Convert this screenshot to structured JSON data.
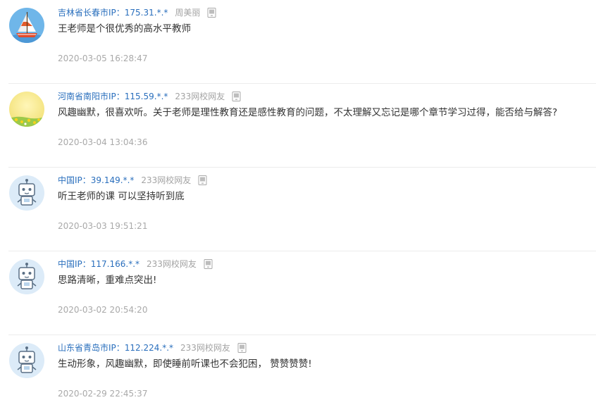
{
  "colors": {
    "location": "#2a6fbd",
    "muted": "#a3a3a3",
    "text": "#333333",
    "divider": "#ececec"
  },
  "comments": [
    {
      "avatar": "sailboat-avatar",
      "location": "吉林省长春市IP：175.31.*.*",
      "user": "周美丽",
      "content": "王老师是个很优秀的高水平教师",
      "time": "2020-03-05 16:28:47"
    },
    {
      "avatar": "flower-field-avatar",
      "location": "河南省南阳市IP：115.59.*.*",
      "user": "233网校网友",
      "content": "风趣幽默，很喜欢听。关于老师是理性教育还是感性教育的问题，不太理解又忘记是哪个章节学习过得，能否给与解答?",
      "time": "2020-03-04 13:04:36"
    },
    {
      "avatar": "robot-avatar",
      "location": "中国IP：39.149.*.*",
      "user": "233网校网友",
      "content": "听王老师的课 可以坚持听到底",
      "time": "2020-03-03 19:51:21"
    },
    {
      "avatar": "robot-avatar",
      "location": "中国IP：117.166.*.*",
      "user": "233网校网友",
      "content": "思路清晰，重难点突出!",
      "time": "2020-03-02 20:54:20"
    },
    {
      "avatar": "robot-avatar",
      "location": "山东省青岛市IP：112.224.*.*",
      "user": "233网校网友",
      "content": "生动形象，风趣幽默，即使睡前听课也不会犯困， 赞赞赞赞!",
      "time": "2020-02-29 22:45:37"
    }
  ]
}
